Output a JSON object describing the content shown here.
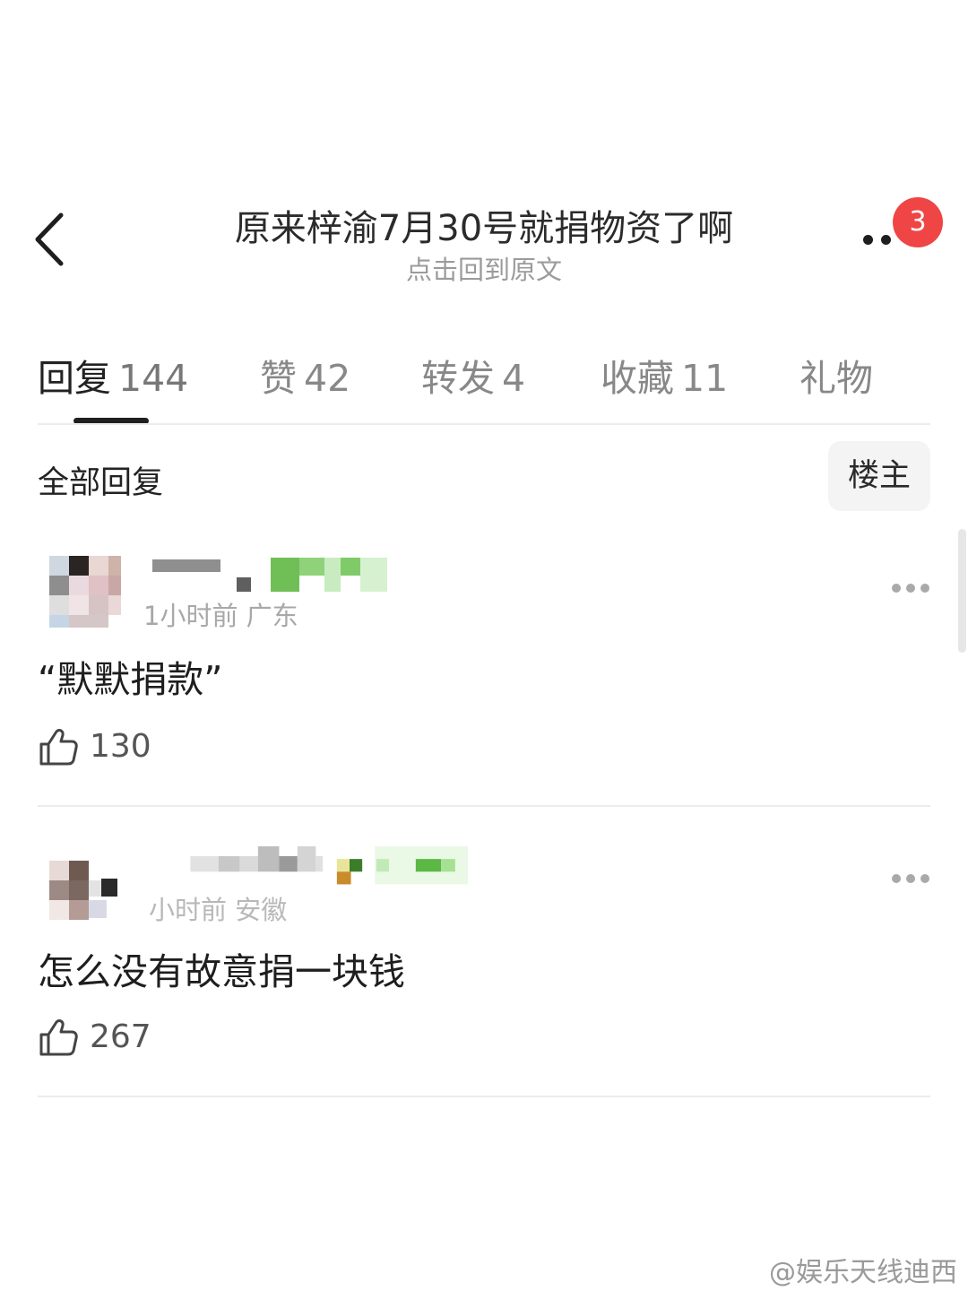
{
  "header": {
    "title": "原来梓渝7月30号就捐物资了啊",
    "subtitle": "点击回到原文",
    "notification_count": "3",
    "back_icon": "chevron-left-icon",
    "more_icon": "more-dots-icon"
  },
  "tabs": [
    {
      "label": "回复",
      "count": "144",
      "active": true
    },
    {
      "label": "赞",
      "count": "42",
      "active": false
    },
    {
      "label": "转发",
      "count": "4",
      "active": false
    },
    {
      "label": "收藏",
      "count": "11",
      "active": false
    },
    {
      "label": "礼物",
      "count": "",
      "active": false
    }
  ],
  "section": {
    "title": "全部回复",
    "filter_label": "楼主"
  },
  "comments": [
    {
      "meta": "1小时前 广东",
      "text": "“默默捐款”",
      "likes": "130"
    },
    {
      "meta": "小时前 安徽",
      "text": "怎么没有故意捐一块钱",
      "likes": "267"
    }
  ],
  "watermark": "@娱乐天线迪西",
  "colors": {
    "badge": "#ef4545",
    "tab_underline": "#1f1f1f",
    "text_primary": "#222222",
    "text_secondary": "#9b9b9b"
  }
}
